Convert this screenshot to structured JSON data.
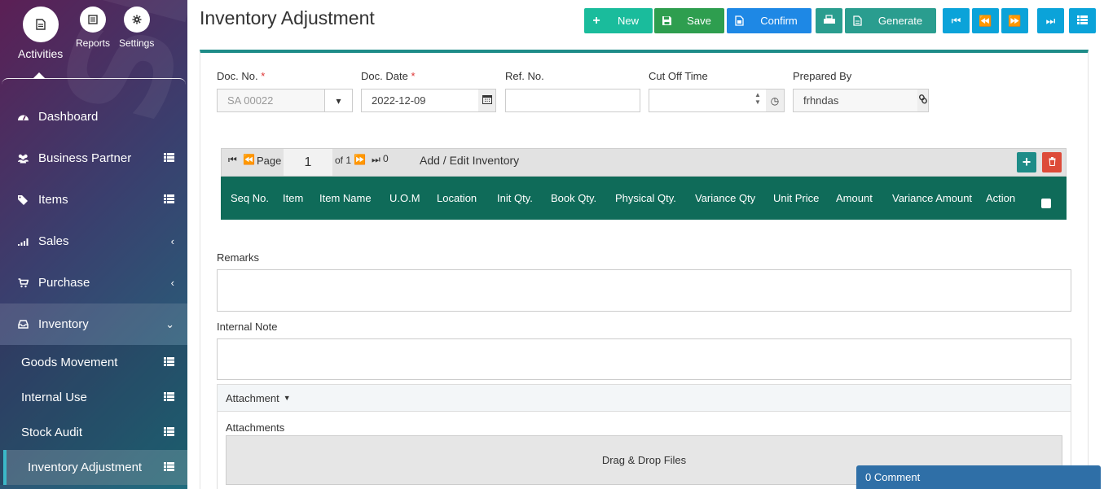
{
  "sidebar": {
    "top_tabs": [
      {
        "label": "Activities",
        "icon": "document-icon"
      },
      {
        "label": "Reports",
        "icon": "report-icon"
      },
      {
        "label": "Settings",
        "icon": "gear-icon"
      }
    ],
    "items": [
      {
        "label": "Dashboard",
        "icon": "dashboard-icon"
      },
      {
        "label": "Business Partner",
        "icon": "users-icon"
      },
      {
        "label": "Items",
        "icon": "tags-icon"
      },
      {
        "label": "Sales",
        "icon": "bar-chart-icon"
      },
      {
        "label": "Purchase",
        "icon": "cart-icon"
      },
      {
        "label": "Inventory",
        "icon": "inbox-icon"
      }
    ],
    "sub_items": [
      {
        "label": "Goods Movement"
      },
      {
        "label": "Internal Use"
      },
      {
        "label": "Stock Audit"
      },
      {
        "label": "Inventory Adjustment"
      }
    ]
  },
  "header": {
    "title": "Inventory Adjustment",
    "buttons": {
      "new": "New",
      "save": "Save",
      "confirm": "Confirm",
      "generate": "Generate"
    }
  },
  "form": {
    "doc_no": {
      "label": "Doc. No.",
      "required": "*",
      "placeholder": "SA 00022"
    },
    "doc_date": {
      "label": "Doc. Date",
      "required": "*",
      "value": "2022-12-09"
    },
    "ref_no": {
      "label": "Ref. No.",
      "value": ""
    },
    "cut_off_time": {
      "label": "Cut Off Time",
      "value": ""
    },
    "prepared_by": {
      "label": "Prepared By",
      "value": "frhndas"
    }
  },
  "grid": {
    "page_label": "Page",
    "page_value": "1",
    "of_label": "of 1",
    "count": "0",
    "title": "Add / Edit Inventory",
    "columns": [
      "Seq No.",
      "Item",
      "Item Name",
      "U.O.M",
      "Location",
      "Init Qty.",
      "Book Qty.",
      "Physical Qty.",
      "Variance Qty",
      "Unit Price",
      "Amount",
      "Variance Amount",
      "Action"
    ]
  },
  "remarks_label": "Remarks",
  "internal_note_label": "Internal Note",
  "attachment": {
    "header": "Attachment",
    "label": "Attachments",
    "dropzone": "Drag & Drop Files"
  },
  "comment_bar": "0 Comment",
  "colors": {
    "grid_header": "#0f6b59",
    "panel_border": "#1e8c88",
    "new_button": "#1abc9c",
    "save_button": "#2e9e4f",
    "confirm_button": "#1e88e5",
    "nav_button": "#0ba3d9",
    "delete_button": "#dd4b39"
  }
}
